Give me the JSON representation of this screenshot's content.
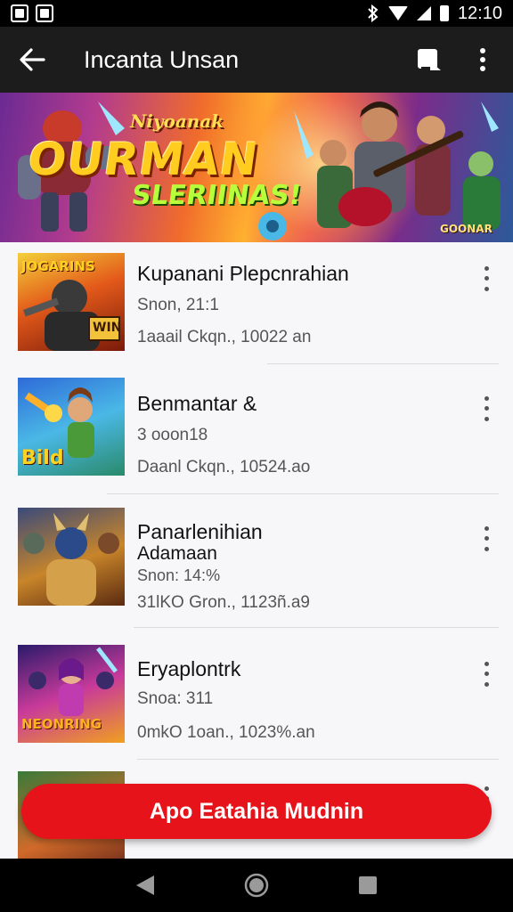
{
  "status_bar": {
    "time": "12:10",
    "icons": [
      "image-notif-icon",
      "image-notif-icon",
      "bluetooth-icon",
      "wifi-icon",
      "cell-signal-icon",
      "battery-icon"
    ]
  },
  "app_bar": {
    "title": "Incanta Unsan",
    "back_icon": "arrow-left-icon",
    "actions": [
      "cast-icon",
      "more-vert-icon"
    ]
  },
  "banner": {
    "line1": "Niyoanak",
    "line2": "OURMAN",
    "line3": "SLERIINAS!",
    "corner": "GOONAR"
  },
  "items": [
    {
      "title": "Kupanani Plepcnrahian",
      "line2": "Snon, 21:1",
      "line3": "1aaail Ckqn., 10022 an",
      "thumb_label": "JOGARINS",
      "thumb_label_2": "WIN"
    },
    {
      "title": "Benmantar &",
      "line2": "3 ooon18",
      "line3": "Daanl Ckqn., 10524.ao",
      "thumb_label": "Bild"
    },
    {
      "title": "Panarlenihian",
      "title_2": "Adamaan",
      "line2": "Snon: 14:%",
      "line3": "31lKO Gron., 1123ñ.a9",
      "thumb_label": ""
    },
    {
      "title": "Eryaplontrk",
      "line2": "Snoa: 311",
      "line3": "0mkO 1oan., 1023%.an",
      "thumb_label": "NEONRING"
    },
    {
      "title": "",
      "line2": "",
      "line3": "",
      "thumb_label": ""
    }
  ],
  "cta": {
    "label": "Apo Eatahia Mudnin"
  },
  "nav": [
    "back-triangle-icon",
    "home-circle-icon",
    "recents-square-icon"
  ],
  "colors": {
    "accent": "#e6141a",
    "app_bar": "#1c1c1c"
  }
}
